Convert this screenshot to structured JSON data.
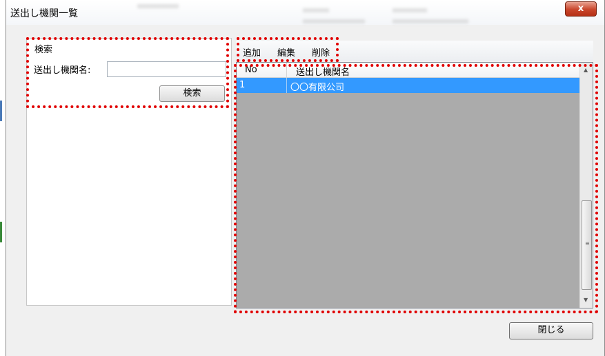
{
  "window": {
    "title": "送出し機関一覧",
    "close_glyph": "x"
  },
  "search": {
    "group_label": "検索",
    "field_label": "送出し機関名:",
    "field_value": "",
    "button_label": "検索"
  },
  "toolbar": {
    "add_label": "追加",
    "edit_label": "編集",
    "delete_label": "削除"
  },
  "grid": {
    "columns": [
      "No",
      "送出し機関名"
    ],
    "rows": [
      {
        "no": "1",
        "name": "〇〇有限公司"
      }
    ],
    "selected_row": 0
  },
  "footer": {
    "close_label": "閉じる"
  },
  "colors": {
    "highlight": "#e00000",
    "selection": "#3399ff",
    "grid_background": "#ababab"
  }
}
